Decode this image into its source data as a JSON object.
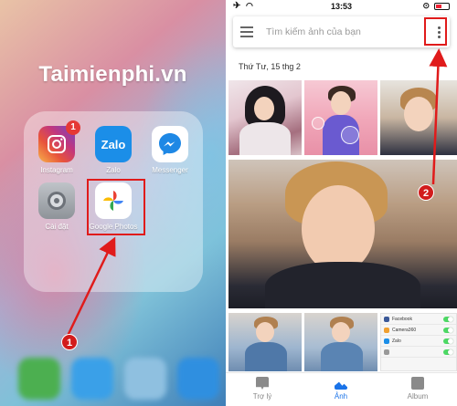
{
  "home": {
    "brand": "Taimienphi.vn",
    "apps": [
      {
        "label": "Instagram",
        "badge": "1"
      },
      {
        "label": "Zalo",
        "glyph": "Zalo"
      },
      {
        "label": "Messenger"
      },
      {
        "label": "Cài đặt"
      },
      {
        "label": "Google Photos"
      }
    ]
  },
  "photos": {
    "status_time": "13:53",
    "search_placeholder": "Tìm kiếm ảnh của bạn",
    "date_header": "Thứ Tư, 15 thg 2",
    "settings_rows": [
      "Facebook",
      "Camera360",
      "Zalo",
      ""
    ],
    "nav": {
      "assistant": "Trợ lý",
      "photos": "Ảnh",
      "albums": "Album"
    }
  },
  "callouts": {
    "step1": "1",
    "step2": "2"
  },
  "colors": {
    "annotation": "#e01b1b",
    "active": "#1a73e8"
  }
}
